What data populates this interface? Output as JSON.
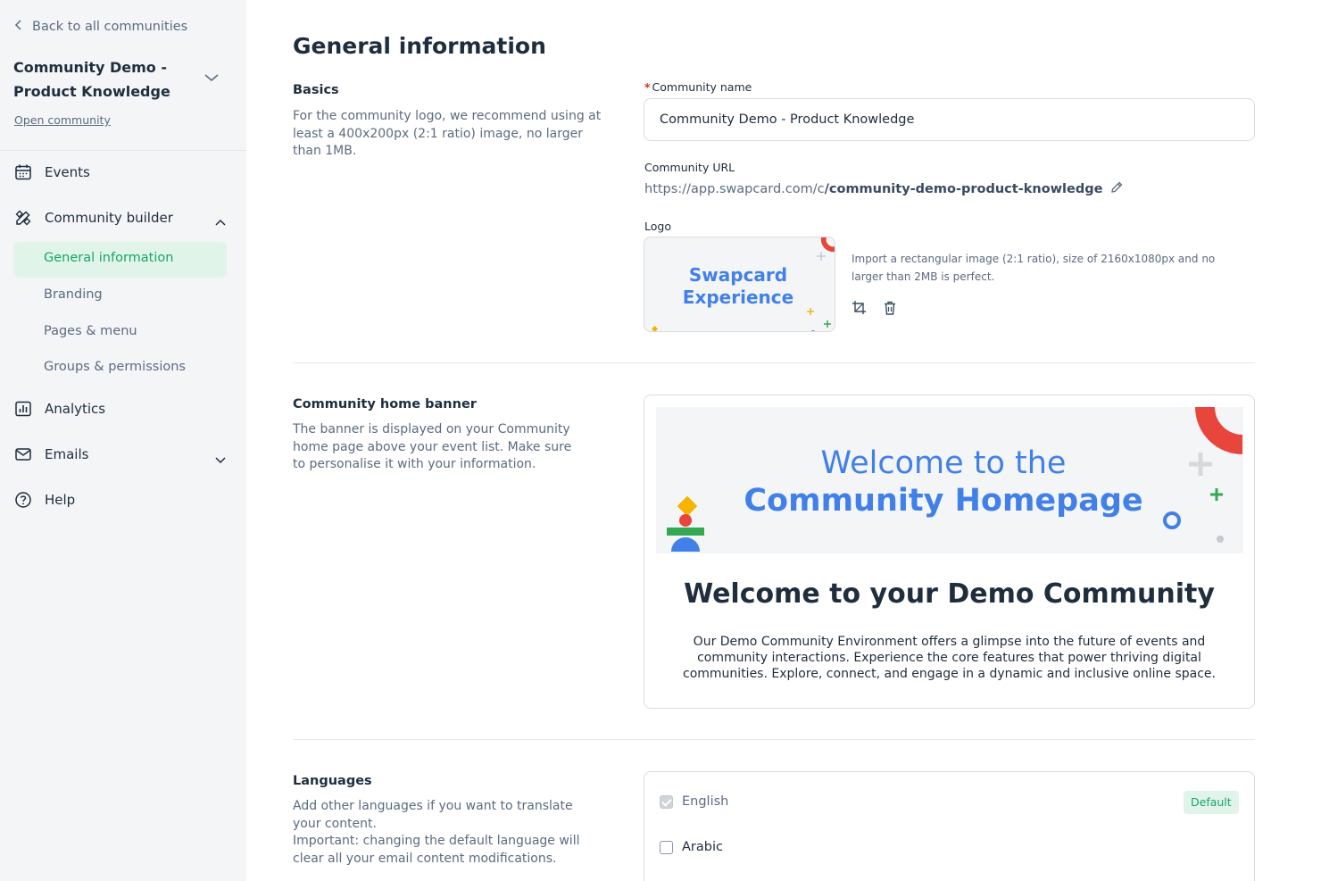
{
  "sidebar": {
    "back_label": "Back to all communities",
    "community_title": "Community Demo - Product Knowledge",
    "open_community": "Open community",
    "nav": {
      "events": "Events",
      "community_builder": "Community builder",
      "analytics": "Analytics",
      "emails": "Emails",
      "help": "Help"
    },
    "sub": {
      "general_information": "General information",
      "branding": "Branding",
      "pages_menu": "Pages & menu",
      "groups_permissions": "Groups & permissions"
    },
    "active_item": "General information"
  },
  "main": {
    "page_title": "General information",
    "basics": {
      "title": "Basics",
      "description": "For the community logo, we recommend using at least a 400x200px (2:1 ratio) image, no larger than 1MB.",
      "name_required_marker": "*",
      "name_label": "Community name",
      "name_value": "Community Demo - Product Knowledge",
      "url_label": "Community URL",
      "url_prefix": "https://app.swapcard.com/c",
      "url_slug": "/community-demo-product-knowledge",
      "logo_label": "Logo",
      "logo_text_line1": "Swapcard",
      "logo_text_line2": "Experience",
      "logo_hint": "Import a rectangular image (2:1 ratio), size of 2160x1080px and no larger than 2MB is perfect."
    },
    "banner": {
      "title": "Community home banner",
      "description": "The banner is displayed on your Community home page above your event list. Make sure to personalise it with your information.",
      "image_line1": "Welcome to the",
      "image_line2": "Community Homepage",
      "heading": "Welcome to your Demo Community",
      "body": "Our Demo Community Environment offers a glimpse into the future of events and community interactions. Experience the core features that power thriving digital communities. Explore, connect, and engage in a dynamic and inclusive online space."
    },
    "languages": {
      "title": "Languages",
      "description_line1": "Add other languages if you want to translate your content.",
      "description_line2": "Important: changing the default language will clear all your email content modifications.",
      "items": [
        {
          "label": "English",
          "checked": true,
          "disabled": true
        },
        {
          "label": "Arabic",
          "checked": false,
          "disabled": false
        }
      ],
      "default_badge": "Default"
    }
  },
  "colors": {
    "accent_green": "#17a567",
    "active_bg": "#e1f4ea",
    "brand_blue": "#4180e8",
    "required_red": "#d93025"
  }
}
